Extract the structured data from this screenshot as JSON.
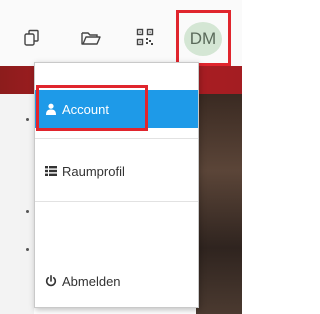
{
  "toolbar": {
    "icons": [
      "copy-icon",
      "folder-open-icon",
      "qr-code-icon"
    ],
    "avatar_initials": "DM"
  },
  "menu": {
    "items": [
      {
        "label": "Account",
        "icon": "user-icon",
        "active": true
      },
      {
        "label": "Raumprofil",
        "icon": "list-icon",
        "active": false
      },
      {
        "label": "Abmelden",
        "icon": "power-icon",
        "active": false
      }
    ]
  },
  "colors": {
    "active_item_bg": "#1e9ae8",
    "highlight_border": "#e0252d",
    "avatar_bg": "#d4e6d4"
  }
}
